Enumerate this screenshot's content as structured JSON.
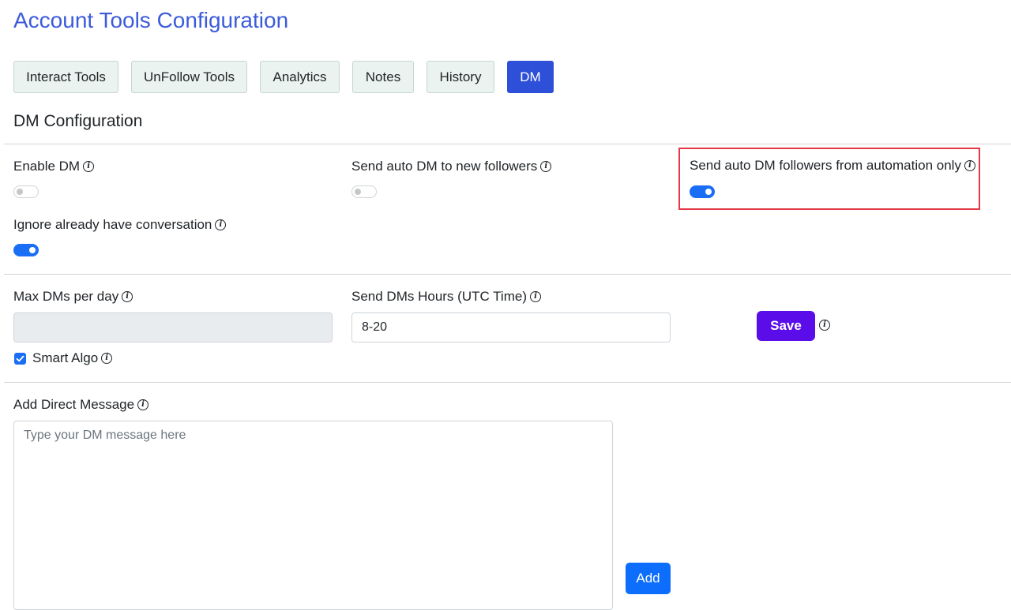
{
  "page_title": "Account Tools Configuration",
  "tabs": [
    {
      "label": "Interact Tools",
      "active": false
    },
    {
      "label": "UnFollow Tools",
      "active": false
    },
    {
      "label": "Analytics",
      "active": false
    },
    {
      "label": "Notes",
      "active": false
    },
    {
      "label": "History",
      "active": false
    },
    {
      "label": "DM",
      "active": true
    }
  ],
  "section_title": "DM Configuration",
  "toggles": {
    "enable_dm": {
      "label": "Enable DM",
      "on": false
    },
    "send_auto_dm_new_followers": {
      "label": "Send auto DM to new followers",
      "on": false
    },
    "send_auto_dm_automation_only": {
      "label": "Send auto DM followers from automation only",
      "on": true
    },
    "ignore_existing_conversation": {
      "label": "Ignore already have conversation",
      "on": true
    }
  },
  "limits": {
    "max_dms_label": "Max DMs per day",
    "max_dms_value": "",
    "send_hours_label": "Send DMs Hours (UTC Time)",
    "send_hours_value": "8-20",
    "save_label": "Save",
    "smart_algo_label": "Smart Algo",
    "smart_algo_checked": true
  },
  "message": {
    "label": "Add Direct Message",
    "placeholder": "Type your DM message here",
    "value": "",
    "add_label": "Add"
  },
  "icons": {
    "info": "info-icon",
    "check": "check-icon"
  },
  "colors": {
    "title": "#3b5bdb",
    "tab_active": "#2e4fd8",
    "tab_inactive_bg": "#eaf3ef",
    "toggle_on": "#1a6ef5",
    "save_button": "#5a0de8",
    "add_button": "#0d6efd",
    "highlight_border": "#e53946"
  }
}
